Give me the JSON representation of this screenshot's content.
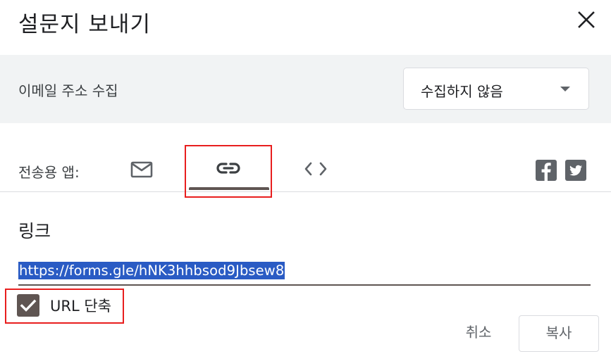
{
  "dialog": {
    "title": "설문지 보내기",
    "close_icon": "close-icon"
  },
  "email_collection": {
    "label": "이메일 주소 수집",
    "selected_option": "수집하지 않음",
    "dropdown_icon": "dropdown-arrow-icon"
  },
  "send_via": {
    "label": "전송용 앱:",
    "tabs": [
      {
        "icon": "email-icon",
        "selected": false
      },
      {
        "icon": "link-icon",
        "selected": true
      },
      {
        "icon": "embed-code-icon",
        "selected": false
      }
    ],
    "social": [
      {
        "icon": "facebook-icon"
      },
      {
        "icon": "twitter-icon"
      }
    ]
  },
  "link_panel": {
    "heading": "링크",
    "url": "https://forms.gle/hNK3hhbsod9Jbsew8",
    "shorten_label": "URL 단축",
    "shorten_checked": true
  },
  "actions": {
    "cancel_label": "취소",
    "copy_label": "복사"
  },
  "colors": {
    "accent": "#5f5552",
    "selection": "#2a5bc4",
    "highlight_annotation": "#e81e1e",
    "section_background": "#f1f3f4"
  }
}
